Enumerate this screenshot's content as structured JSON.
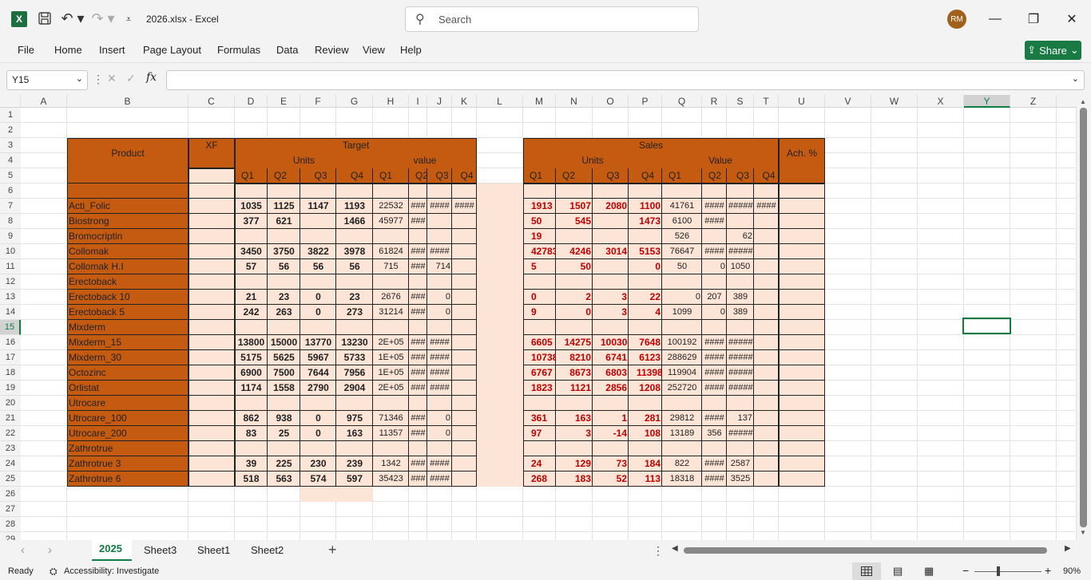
{
  "app": {
    "doc_title": "2026.xlsx  -  Excel",
    "search_placeholder": "Search",
    "avatar": "RM",
    "share": "Share"
  },
  "ribbon": {
    "tabs": [
      "File",
      "Home",
      "Insert",
      "Page Layout",
      "Formulas",
      "Data",
      "Review",
      "View",
      "Help"
    ]
  },
  "formula_bar": {
    "name_box": "Y15",
    "fx": "fx",
    "value": ""
  },
  "columns": [
    "A",
    "B",
    "C",
    "D",
    "E",
    "F",
    "G",
    "H",
    "I",
    "J",
    "K",
    "L",
    "M",
    "N",
    "O",
    "P",
    "Q",
    "R",
    "S",
    "T",
    "U",
    "V",
    "W",
    "X",
    "Y",
    "Z"
  ],
  "rows": [
    "1",
    "2",
    "3",
    "4",
    "5",
    "6",
    "7",
    "8",
    "9",
    "10",
    "11",
    "12",
    "13",
    "14",
    "15",
    "16",
    "17",
    "18",
    "19",
    "20",
    "21",
    "22",
    "23",
    "24",
    "25",
    "26",
    "27",
    "28",
    "29"
  ],
  "header": {
    "product": "Product",
    "xf": "XF",
    "target": "Target",
    "sales": "Sales",
    "units": "Units",
    "value_t": "value",
    "value_s": "Value",
    "ach": "Ach. %",
    "q": [
      "Q1",
      "Q2",
      "Q3",
      "Q4"
    ]
  },
  "products": [
    "Acti_Folic",
    "Biostrong",
    "Bromocriptin",
    "Collomak",
    "Collomak H.I",
    "Erectoback",
    "Erectoback 10",
    "Erectoback 5",
    "Mixderm",
    "Mixderm_15",
    "Mixderm_30",
    "Octozinc",
    "Orlistat",
    "Utrocare",
    "Utrocare_100",
    "Utrocare_200",
    "Zathrotrue",
    "Zathrotrue 3",
    "Zathrotrue 6"
  ],
  "target_units": [
    [
      "1035",
      "1125",
      "1147",
      "1193"
    ],
    [
      "377",
      "621",
      "",
      "1466"
    ],
    [
      "",
      "",
      "",
      ""
    ],
    [
      "3450",
      "3750",
      "3822",
      "3978"
    ],
    [
      "57",
      "56",
      "56",
      "56"
    ],
    [
      "",
      "",
      "",
      ""
    ],
    [
      "21",
      "23",
      "0",
      "23"
    ],
    [
      "242",
      "263",
      "0",
      "273"
    ],
    [
      "",
      "",
      "",
      ""
    ],
    [
      "13800",
      "15000",
      "13770",
      "13230"
    ],
    [
      "5175",
      "5625",
      "5967",
      "5733"
    ],
    [
      "6900",
      "7500",
      "7644",
      "7956"
    ],
    [
      "1174",
      "1558",
      "2790",
      "2904"
    ],
    [
      "",
      "",
      "",
      ""
    ],
    [
      "862",
      "938",
      "0",
      "975"
    ],
    [
      "83",
      "25",
      "0",
      "163"
    ],
    [
      "",
      "",
      "",
      ""
    ],
    [
      "39",
      "225",
      "230",
      "239"
    ],
    [
      "518",
      "563",
      "574",
      "597"
    ]
  ],
  "target_value": [
    [
      "22532",
      "###",
      "####",
      "####"
    ],
    [
      "45977",
      "###",
      "",
      ""
    ],
    [
      "",
      "",
      "",
      ""
    ],
    [
      "61824",
      "###",
      "####",
      ""
    ],
    [
      "715",
      "###",
      "714",
      ""
    ],
    [
      "",
      "",
      "",
      ""
    ],
    [
      "2676",
      "###",
      "0",
      ""
    ],
    [
      "31214",
      "###",
      "0",
      ""
    ],
    [
      "",
      "",
      "",
      ""
    ],
    [
      "2E+05",
      "###",
      "####",
      ""
    ],
    [
      "1E+05",
      "###",
      "####",
      ""
    ],
    [
      "1E+05",
      "###",
      "####",
      ""
    ],
    [
      "2E+05",
      "###",
      "####",
      ""
    ],
    [
      "",
      "",
      "",
      ""
    ],
    [
      "71346",
      "###",
      "0",
      ""
    ],
    [
      "11357",
      "###",
      "0",
      ""
    ],
    [
      "",
      "",
      "",
      ""
    ],
    [
      "1342",
      "###",
      "####",
      ""
    ],
    [
      "35423",
      "###",
      "####",
      ""
    ]
  ],
  "sales_units": [
    [
      "1913",
      "1507",
      "2080",
      "1100"
    ],
    [
      "50",
      "545",
      "",
      "1473"
    ],
    [
      "19",
      "",
      "",
      ""
    ],
    [
      "42783",
      "4246",
      "3014",
      "5153"
    ],
    [
      "5",
      "50",
      "",
      "0"
    ],
    [
      "",
      "",
      "",
      ""
    ],
    [
      "0",
      "2",
      "3",
      "22"
    ],
    [
      "9",
      "0",
      "3",
      "4"
    ],
    [
      "",
      "",
      "",
      ""
    ],
    [
      "6605",
      "14275",
      "10030",
      "7648"
    ],
    [
      "10738",
      "8210",
      "6741",
      "6123"
    ],
    [
      "6767",
      "8673",
      "6803",
      "11398"
    ],
    [
      "1823",
      "1121",
      "2856",
      "1208"
    ],
    [
      "",
      "",
      "",
      ""
    ],
    [
      "361",
      "163",
      "1",
      "281"
    ],
    [
      "97",
      "3",
      "-14",
      "108"
    ],
    [
      "",
      "",
      "",
      ""
    ],
    [
      "24",
      "129",
      "73",
      "184"
    ],
    [
      "268",
      "183",
      "52",
      "113"
    ]
  ],
  "sales_value": [
    [
      "41761",
      "####",
      "#####",
      "####"
    ],
    [
      "6100",
      "####",
      "",
      ""
    ],
    [
      "526",
      "",
      "62",
      ""
    ],
    [
      "76647",
      "####",
      "#####",
      ""
    ],
    [
      "50",
      "0",
      "1050",
      ""
    ],
    [
      "",
      "",
      "",
      ""
    ],
    [
      "0",
      "207",
      "389",
      ""
    ],
    [
      "1099",
      "0",
      "389",
      ""
    ],
    [
      "",
      "",
      "",
      ""
    ],
    [
      "100192",
      "####",
      "#####",
      ""
    ],
    [
      "288629",
      "####",
      "#####",
      ""
    ],
    [
      "119904",
      "####",
      "#####",
      ""
    ],
    [
      "252720",
      "####",
      "#####",
      ""
    ],
    [
      "",
      "",
      "",
      ""
    ],
    [
      "29812",
      "####",
      "137",
      ""
    ],
    [
      "13189",
      "356",
      "#####",
      ""
    ],
    [
      "",
      "",
      "",
      ""
    ],
    [
      "822",
      "####",
      "2587",
      ""
    ],
    [
      "18318",
      "####",
      "3525",
      ""
    ]
  ],
  "sheets": [
    "2025",
    "Sheet3",
    "Sheet1",
    "Sheet2"
  ],
  "status": {
    "ready": "Ready",
    "accessibility": "Accessibility: Investigate",
    "zoom": "90%"
  },
  "colors": {
    "header_fill": "#c55a11",
    "light_fill": "#fce4d6",
    "sales_text": "#c00000",
    "excel_green": "#1d6f42"
  }
}
